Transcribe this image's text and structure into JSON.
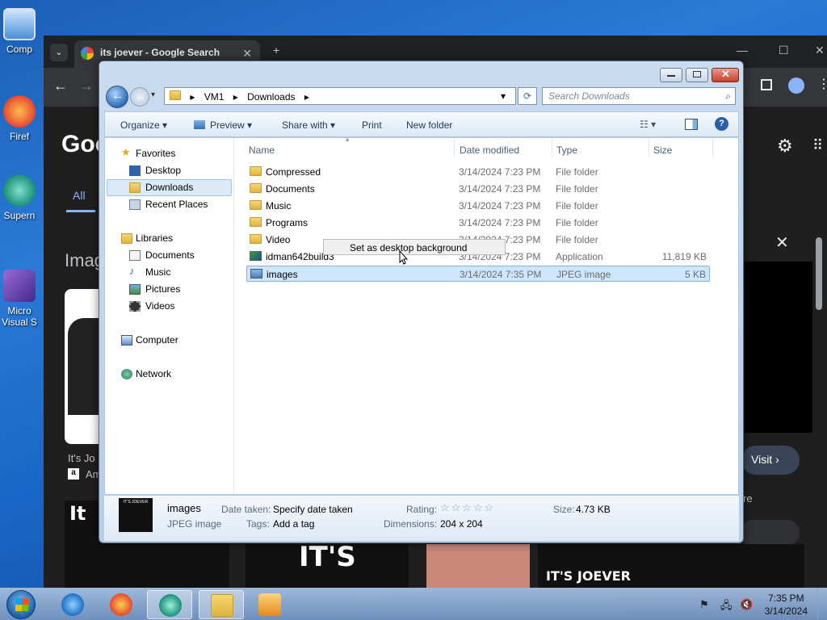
{
  "desktop": {
    "icons": [
      {
        "label": "Comp"
      },
      {
        "label": "Firef"
      },
      {
        "label": "Supern"
      },
      {
        "label": "Micro"
      },
      {
        "label": "Visual S"
      }
    ]
  },
  "chrome": {
    "tab_title": "its joever - Google Search",
    "logo": "Goo",
    "nav_all": "All",
    "images_heading": "Imag",
    "caption_1": "It's Jo",
    "caption_2": "Am",
    "visit_label": "Visit ›",
    "meme_text_1": "It",
    "meme_text_2": "IT'S",
    "meme_text_3": "IT'S JOEVER",
    "side_text": "re"
  },
  "explorer": {
    "breadcrumb": [
      "VM1",
      "Downloads"
    ],
    "search_placeholder": "Search Downloads",
    "commands": {
      "organize": "Organize ▾",
      "preview": "Preview ▾",
      "share_with": "Share with ▾",
      "print": "Print",
      "new_folder": "New folder"
    },
    "nav": {
      "favorites": "Favorites",
      "desktop": "Desktop",
      "downloads": "Downloads",
      "recent_places": "Recent Places",
      "libraries": "Libraries",
      "documents": "Documents",
      "music": "Music",
      "pictures": "Pictures",
      "videos": "Videos",
      "computer": "Computer",
      "network": "Network"
    },
    "columns": {
      "name": "Name",
      "date": "Date modified",
      "type": "Type",
      "size": "Size"
    },
    "files": [
      {
        "name": "Compressed",
        "date": "3/14/2024 7:23 PM",
        "type": "File folder",
        "size": ""
      },
      {
        "name": "Documents",
        "date": "3/14/2024 7:23 PM",
        "type": "File folder",
        "size": ""
      },
      {
        "name": "Music",
        "date": "3/14/2024 7:23 PM",
        "type": "File folder",
        "size": ""
      },
      {
        "name": "Programs",
        "date": "3/14/2024 7:23 PM",
        "type": "File folder",
        "size": ""
      },
      {
        "name": "Video",
        "date": "3/14/2024 7:23 PM",
        "type": "File folder",
        "size": ""
      },
      {
        "name": "idman642build3",
        "date": "3/14/2024 7:23 PM",
        "type": "Application",
        "size": "11,819 KB"
      },
      {
        "name": "images",
        "date": "3/14/2024 7:35 PM",
        "type": "JPEG image",
        "size": "5 KB"
      }
    ],
    "context_menu_item": "Set as desktop background",
    "details": {
      "name": "images",
      "kind": "JPEG image",
      "date_taken_label": "Date taken:",
      "date_taken_value": "Specify date taken",
      "tags_label": "Tags:",
      "tags_value": "Add a tag",
      "rating_label": "Rating:",
      "rating_value": 0,
      "dimensions_label": "Dimensions:",
      "dimensions_value": "204 x 204",
      "size_label": "Size:",
      "size_value": "4.73 KB",
      "thumb_text": "IT'S JOEVER"
    }
  },
  "taskbar": {
    "time": "7:35 PM",
    "date": "3/14/2024"
  }
}
